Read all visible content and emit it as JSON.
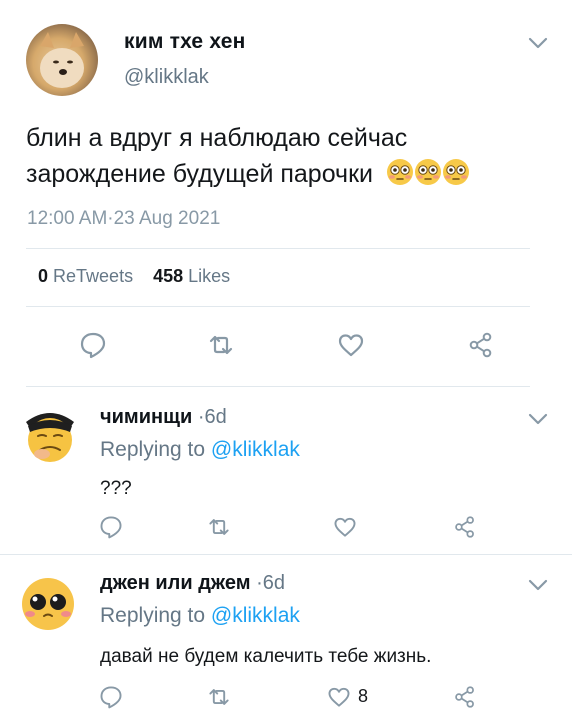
{
  "main_tweet": {
    "author_name": "ким тхе хен",
    "handle": "@klikklak",
    "text_line1": "блин а вдруг я наблюдаю сейчас",
    "text_line2": "зарождение будущей парочки",
    "emoji": "flushed-face-emoji x3",
    "timestamp": "12:00 AM·23 Aug 2021",
    "retweets_count": "0",
    "retweets_label": "ReTweets",
    "likes_count": "458",
    "likes_label": "Likes"
  },
  "replies": [
    {
      "author_name": "чиминщи",
      "time": "·6d",
      "replying_prefix": "Replying to",
      "replying_handle": "@klikklak",
      "text": "???",
      "like_count": ""
    },
    {
      "author_name": "джен или джем",
      "time": "·6d",
      "replying_prefix": "Replying to",
      "replying_handle": "@klikklak",
      "text": "давай не будем калечить тебе жизнь.",
      "like_count": "8"
    }
  ],
  "colors": {
    "muted": "#657786",
    "link": "#1da1f2",
    "divider": "#e1e8ed",
    "icon": "#8899a6"
  }
}
